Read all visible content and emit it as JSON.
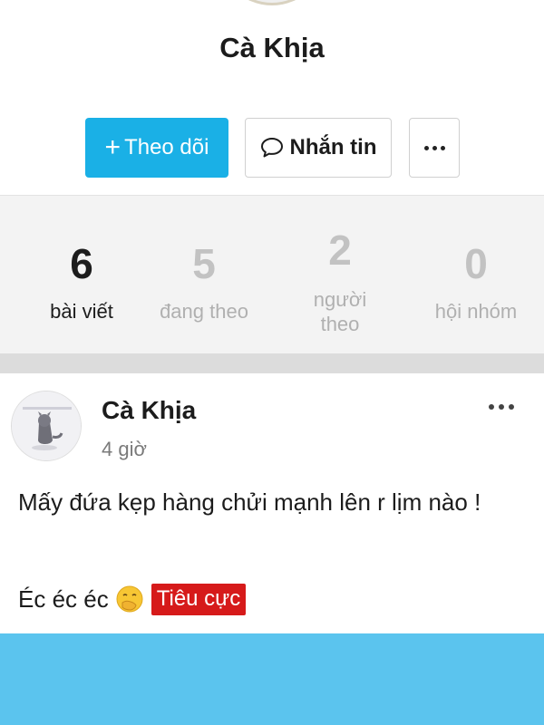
{
  "profile": {
    "name": "Cà Khịa"
  },
  "actions": {
    "follow_label": "Theo dõi",
    "message_label": "Nhắn tin",
    "more_icon": "more-dots-icon"
  },
  "stats": [
    {
      "value": "6",
      "label_lines": [
        "bài viết"
      ],
      "active": true
    },
    {
      "value": "5",
      "label_lines": [
        "đang theo"
      ],
      "active": false
    },
    {
      "value": "2",
      "label_lines": [
        "người",
        "theo"
      ],
      "active": false
    },
    {
      "value": "0",
      "label_lines": [
        "hội nhóm"
      ],
      "active": false
    }
  ],
  "post": {
    "author": "Cà Khịa",
    "time": "4 giờ",
    "text": "Mấy đứa kẹp hàng chửi mạnh lên r lịm nào !",
    "line2_text": "Éc éc éc",
    "emoji": "hand-over-mouth-emoji",
    "tag": "Tiêu cực"
  },
  "colors": {
    "accent": "#1ab0e6",
    "stats_bg": "#f3f3f3",
    "tag_bg": "#d61a1a",
    "bottom_bar": "#5bc4ee"
  }
}
